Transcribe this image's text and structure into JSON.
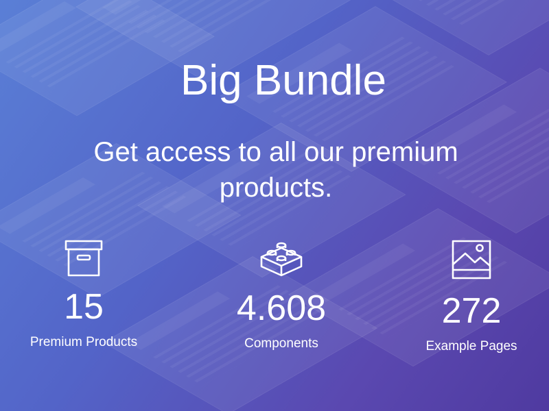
{
  "hero": {
    "title": "Big Bundle",
    "subtitle": "Get access to all our premium products.",
    "stats": [
      {
        "icon": "archive-box-icon",
        "number": "15",
        "label": "Premium Products"
      },
      {
        "icon": "lego-block-icon",
        "number": "4.608",
        "label": "Components"
      },
      {
        "icon": "image-icon",
        "number": "272",
        "label": "Example Pages"
      }
    ]
  },
  "colors": {
    "text": "#ffffff",
    "gradient_start": "#5a7fd6",
    "gradient_end": "#4f3aa0"
  }
}
